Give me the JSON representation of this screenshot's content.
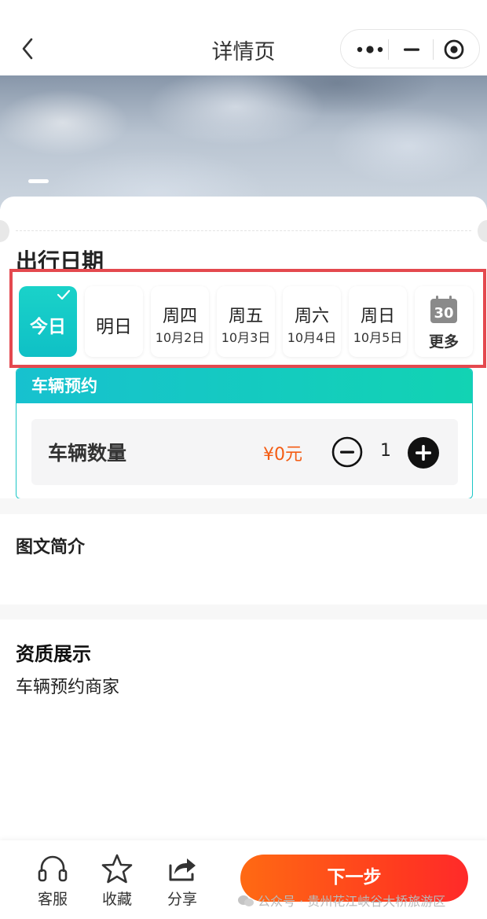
{
  "navbar": {
    "title": "详情页",
    "back_icon": "chevron-left-icon",
    "capsule": {
      "more_icon": "more-dots-icon",
      "minimize_icon": "minus-icon",
      "close_icon": "target-icon"
    }
  },
  "card": {
    "date_heading": "出行日期"
  },
  "date_picker": {
    "highlight_color": "#e4494f",
    "selected_color": "#1ac8c8",
    "chips": [
      {
        "label": "今日",
        "selected": true
      },
      {
        "label": "明日",
        "selected": false
      },
      {
        "weekday": "周四",
        "date": "10月2日"
      },
      {
        "weekday": "周五",
        "date": "10月3日"
      },
      {
        "weekday": "周六",
        "date": "10月4日"
      },
      {
        "weekday": "周日",
        "date": "10月5日"
      }
    ],
    "more": {
      "icon_day": "30",
      "label": "更多"
    }
  },
  "booking": {
    "title": "车辆预约",
    "row_label": "车辆数量",
    "price": "¥0元",
    "quantity": "1",
    "accent_color": "#17c1cf",
    "price_color": "#f45c13"
  },
  "sections": {
    "intro_title": "图文简介",
    "qualification_title": "资质展示",
    "qualification_text": "车辆预约商家"
  },
  "bottom_bar": {
    "tabs": [
      {
        "label": "客服",
        "icon": "headset-icon"
      },
      {
        "label": "收藏",
        "icon": "star-icon"
      },
      {
        "label": "分享",
        "icon": "share-icon"
      }
    ],
    "next_label": "下一步",
    "next_color": "#ff4b1a",
    "watermark": "公众号 · 贵州花江峡谷大桥旅游区"
  }
}
